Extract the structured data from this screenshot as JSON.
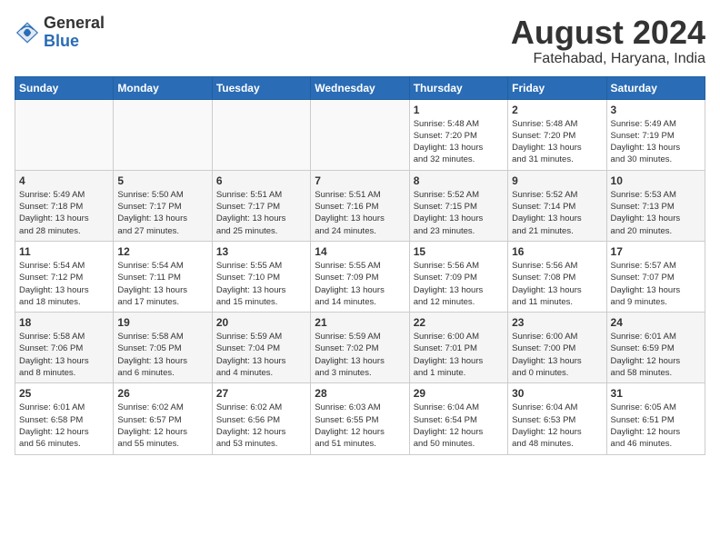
{
  "header": {
    "logo_general": "General",
    "logo_blue": "Blue",
    "month_year": "August 2024",
    "location": "Fatehabad, Haryana, India"
  },
  "weekdays": [
    "Sunday",
    "Monday",
    "Tuesday",
    "Wednesday",
    "Thursday",
    "Friday",
    "Saturday"
  ],
  "rows": [
    {
      "cells": [
        {
          "num": "",
          "info": ""
        },
        {
          "num": "",
          "info": ""
        },
        {
          "num": "",
          "info": ""
        },
        {
          "num": "",
          "info": ""
        },
        {
          "num": "1",
          "info": "Sunrise: 5:48 AM\nSunset: 7:20 PM\nDaylight: 13 hours\nand 32 minutes."
        },
        {
          "num": "2",
          "info": "Sunrise: 5:48 AM\nSunset: 7:20 PM\nDaylight: 13 hours\nand 31 minutes."
        },
        {
          "num": "3",
          "info": "Sunrise: 5:49 AM\nSunset: 7:19 PM\nDaylight: 13 hours\nand 30 minutes."
        }
      ]
    },
    {
      "cells": [
        {
          "num": "4",
          "info": "Sunrise: 5:49 AM\nSunset: 7:18 PM\nDaylight: 13 hours\nand 28 minutes."
        },
        {
          "num": "5",
          "info": "Sunrise: 5:50 AM\nSunset: 7:17 PM\nDaylight: 13 hours\nand 27 minutes."
        },
        {
          "num": "6",
          "info": "Sunrise: 5:51 AM\nSunset: 7:17 PM\nDaylight: 13 hours\nand 25 minutes."
        },
        {
          "num": "7",
          "info": "Sunrise: 5:51 AM\nSunset: 7:16 PM\nDaylight: 13 hours\nand 24 minutes."
        },
        {
          "num": "8",
          "info": "Sunrise: 5:52 AM\nSunset: 7:15 PM\nDaylight: 13 hours\nand 23 minutes."
        },
        {
          "num": "9",
          "info": "Sunrise: 5:52 AM\nSunset: 7:14 PM\nDaylight: 13 hours\nand 21 minutes."
        },
        {
          "num": "10",
          "info": "Sunrise: 5:53 AM\nSunset: 7:13 PM\nDaylight: 13 hours\nand 20 minutes."
        }
      ]
    },
    {
      "cells": [
        {
          "num": "11",
          "info": "Sunrise: 5:54 AM\nSunset: 7:12 PM\nDaylight: 13 hours\nand 18 minutes."
        },
        {
          "num": "12",
          "info": "Sunrise: 5:54 AM\nSunset: 7:11 PM\nDaylight: 13 hours\nand 17 minutes."
        },
        {
          "num": "13",
          "info": "Sunrise: 5:55 AM\nSunset: 7:10 PM\nDaylight: 13 hours\nand 15 minutes."
        },
        {
          "num": "14",
          "info": "Sunrise: 5:55 AM\nSunset: 7:09 PM\nDaylight: 13 hours\nand 14 minutes."
        },
        {
          "num": "15",
          "info": "Sunrise: 5:56 AM\nSunset: 7:09 PM\nDaylight: 13 hours\nand 12 minutes."
        },
        {
          "num": "16",
          "info": "Sunrise: 5:56 AM\nSunset: 7:08 PM\nDaylight: 13 hours\nand 11 minutes."
        },
        {
          "num": "17",
          "info": "Sunrise: 5:57 AM\nSunset: 7:07 PM\nDaylight: 13 hours\nand 9 minutes."
        }
      ]
    },
    {
      "cells": [
        {
          "num": "18",
          "info": "Sunrise: 5:58 AM\nSunset: 7:06 PM\nDaylight: 13 hours\nand 8 minutes."
        },
        {
          "num": "19",
          "info": "Sunrise: 5:58 AM\nSunset: 7:05 PM\nDaylight: 13 hours\nand 6 minutes."
        },
        {
          "num": "20",
          "info": "Sunrise: 5:59 AM\nSunset: 7:04 PM\nDaylight: 13 hours\nand 4 minutes."
        },
        {
          "num": "21",
          "info": "Sunrise: 5:59 AM\nSunset: 7:02 PM\nDaylight: 13 hours\nand 3 minutes."
        },
        {
          "num": "22",
          "info": "Sunrise: 6:00 AM\nSunset: 7:01 PM\nDaylight: 13 hours\nand 1 minute."
        },
        {
          "num": "23",
          "info": "Sunrise: 6:00 AM\nSunset: 7:00 PM\nDaylight: 13 hours\nand 0 minutes."
        },
        {
          "num": "24",
          "info": "Sunrise: 6:01 AM\nSunset: 6:59 PM\nDaylight: 12 hours\nand 58 minutes."
        }
      ]
    },
    {
      "cells": [
        {
          "num": "25",
          "info": "Sunrise: 6:01 AM\nSunset: 6:58 PM\nDaylight: 12 hours\nand 56 minutes."
        },
        {
          "num": "26",
          "info": "Sunrise: 6:02 AM\nSunset: 6:57 PM\nDaylight: 12 hours\nand 55 minutes."
        },
        {
          "num": "27",
          "info": "Sunrise: 6:02 AM\nSunset: 6:56 PM\nDaylight: 12 hours\nand 53 minutes."
        },
        {
          "num": "28",
          "info": "Sunrise: 6:03 AM\nSunset: 6:55 PM\nDaylight: 12 hours\nand 51 minutes."
        },
        {
          "num": "29",
          "info": "Sunrise: 6:04 AM\nSunset: 6:54 PM\nDaylight: 12 hours\nand 50 minutes."
        },
        {
          "num": "30",
          "info": "Sunrise: 6:04 AM\nSunset: 6:53 PM\nDaylight: 12 hours\nand 48 minutes."
        },
        {
          "num": "31",
          "info": "Sunrise: 6:05 AM\nSunset: 6:51 PM\nDaylight: 12 hours\nand 46 minutes."
        }
      ]
    }
  ]
}
